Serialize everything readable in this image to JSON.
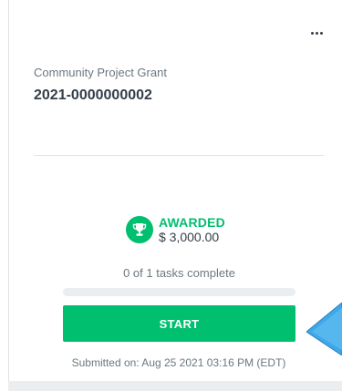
{
  "menu": {
    "icon": "more-horizontal-icon"
  },
  "application": {
    "program_name": "Community Project Grant",
    "app_id": "2021-0000000002"
  },
  "status": {
    "icon": "trophy-icon",
    "label": "AWARDED",
    "amount": "$ 3,000.00",
    "color": "#00bf6f"
  },
  "tasks": {
    "summary": "0 of 1 tasks complete",
    "completed": 0,
    "total": 1,
    "progress_fraction": 0
  },
  "actions": {
    "start_label": "START"
  },
  "submitted": {
    "text": "Submitted on: Aug 25 2021 03:16 PM (EDT)"
  },
  "colors": {
    "accent": "#00bf6f",
    "pointer": "#3fa9e8"
  }
}
